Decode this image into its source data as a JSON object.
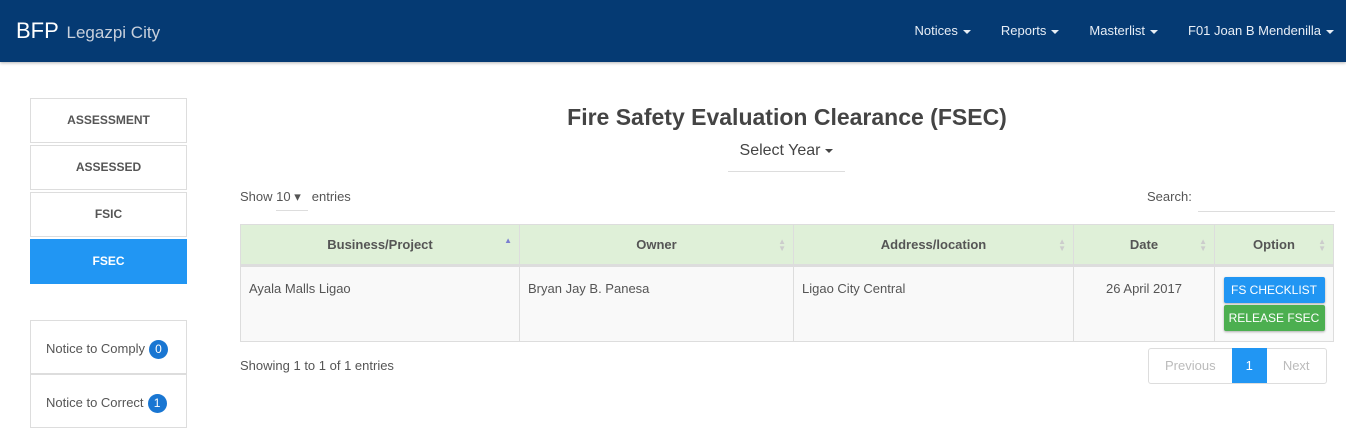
{
  "header": {
    "brand": "BFP",
    "city": "Legazpi City",
    "menu": [
      "Notices",
      "Reports",
      "Masterlist",
      "F01 Joan B Mendenilla"
    ]
  },
  "sidebar": {
    "items": [
      "ASSESSMENT",
      "ASSESSED",
      "FSIC",
      "FSEC"
    ],
    "notices": [
      {
        "label": "Notice to Comply",
        "count": "0"
      },
      {
        "label": "Notice to Correct",
        "count": "1"
      }
    ]
  },
  "main": {
    "title": "Fire Safety Evaluation Clearance (FSEC)",
    "year_select": "Select Year",
    "show": "Show",
    "entries_value": "10",
    "entries": "entries",
    "search_label": "Search:",
    "columns": [
      "Business/Project",
      "Owner",
      "Address/location",
      "Date",
      "Option"
    ],
    "rows": [
      {
        "business": "Ayala Malls Ligao",
        "owner": "Bryan Jay B. Panesa",
        "address": "Ligao City Central",
        "date": "26 April 2017",
        "btn1": "FS CHECKLIST",
        "btn2": "RELEASE FSEC"
      }
    ],
    "info": "Showing 1 to 1 of 1 entries",
    "pagination": {
      "prev": "Previous",
      "page": "1",
      "next": "Next"
    }
  }
}
